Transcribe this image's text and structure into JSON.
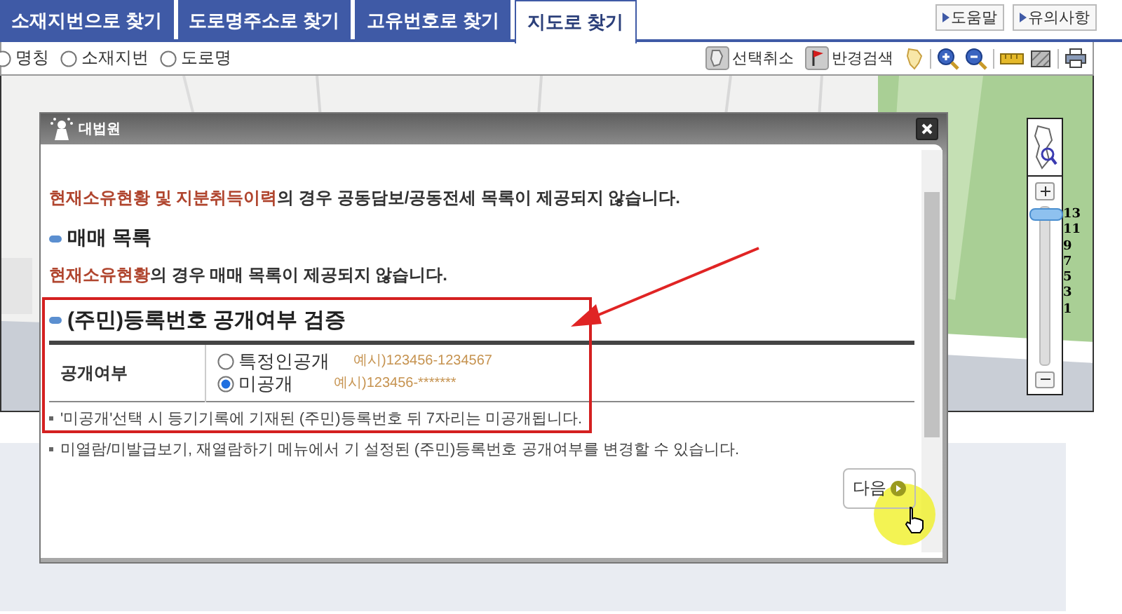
{
  "top_tabs": [
    {
      "label": "소재지번으로 찾기",
      "selected": false
    },
    {
      "label": "도로명주소로 찾기",
      "selected": false
    },
    {
      "label": "고유번호로 찾기",
      "selected": false
    },
    {
      "label": "지도로 찾기",
      "selected": true
    }
  ],
  "header_links": [
    "도움말",
    "유의사항"
  ],
  "search_type": [
    {
      "label": "명칭",
      "selected": false
    },
    {
      "label": "소재지번",
      "selected": false
    },
    {
      "label": "도로명",
      "selected": false
    }
  ],
  "map_tools": [
    "선택취소",
    "반경검색"
  ],
  "zoom_control": {
    "level": 0.95,
    "scale_labels": [
      "13",
      "11",
      "9",
      "7",
      "5",
      "3",
      "1"
    ]
  },
  "dialog": {
    "title": "대법원",
    "sections": [
      {
        "kind": "note",
        "highlight": "현재소유현황 및 지분취득이력",
        "text": "의 경우 공동담보/공동전세 목록이 제공되지 않습니다."
      },
      {
        "kind": "heading",
        "text": "매매 목록"
      },
      {
        "kind": "note",
        "highlight": "현재소유현황",
        "text": "의 경우 매매 목록이 제공되지 않습니다."
      }
    ],
    "disclosure": {
      "heading": "(주민)등록번호 공개여부 검증",
      "label": "공개여부",
      "options": [
        {
          "label": "특정인공개",
          "example": "예시)123456-1234567",
          "selected": false
        },
        {
          "label": "미공개",
          "example": "예시)123456-*******",
          "selected": true
        }
      ]
    },
    "notes": [
      "'미공개'선택 시 등기기록에 기재된 (주민)등록번호 뒤 7자리는 미공개됩니다.",
      "미열람/미발급보기, 재열람하기 메뉴에서 기 설정된 (주민)등록번호 공개여부를 변경할 수 있습니다."
    ],
    "next_button": "다음"
  }
}
